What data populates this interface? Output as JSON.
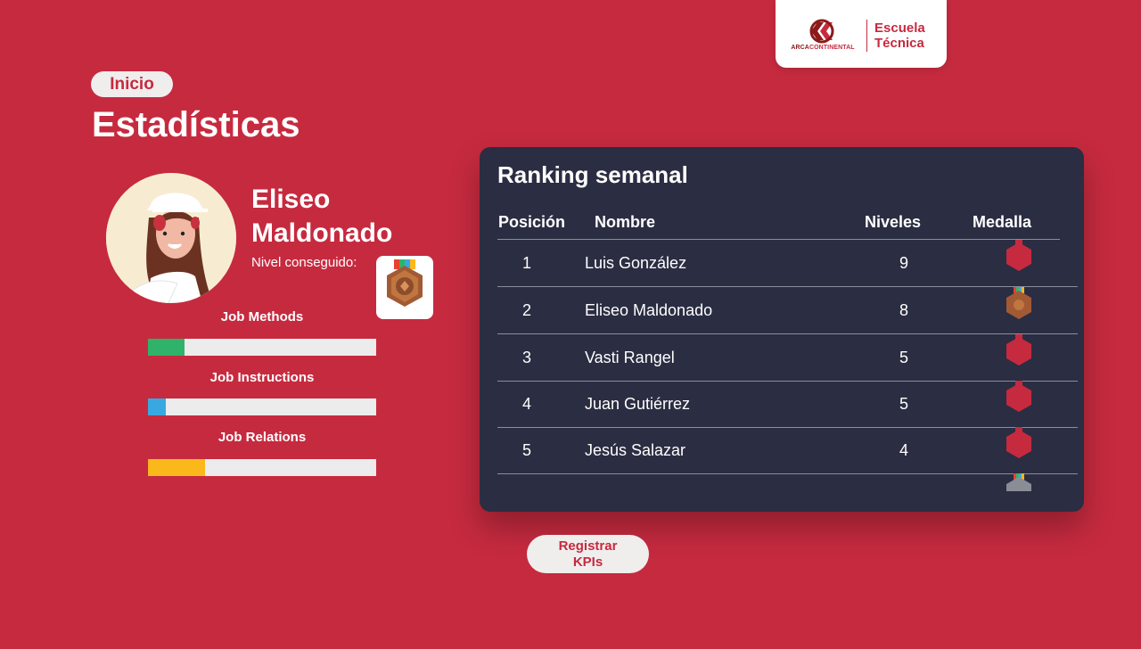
{
  "header": {
    "brand_prefix": "ARCA",
    "brand_suffix": "CONTINENTAL",
    "school_line1": "Escuela",
    "school_line2": "Técnica",
    "brand_color": "#c62a3f"
  },
  "nav": {
    "home_label": "Inicio"
  },
  "page": {
    "title": "Estadísticas"
  },
  "profile": {
    "first_name": "Eliseo",
    "last_name": "Maldonado",
    "level_label": "Nivel conseguido:",
    "level_icon": "bronze-medal-icon"
  },
  "skills": [
    {
      "label": "Job Methods",
      "progress": 0.16,
      "color": "#2fb36b"
    },
    {
      "label": "Job Instructions",
      "progress": 0.08,
      "color": "#3aa8e0"
    },
    {
      "label": "Job Relations",
      "progress": 0.25,
      "color": "#fbb81b"
    }
  ],
  "ranking": {
    "title": "Ranking semanal",
    "columns": {
      "position": "Posición",
      "name": "Nombre",
      "levels": "Niveles",
      "medal": "Medalla"
    },
    "rows": [
      {
        "position": "1",
        "name": "Luis González",
        "levels": "9",
        "medal": "red-medal-icon"
      },
      {
        "position": "2",
        "name": "Eliseo Maldonado",
        "levels": "8",
        "medal": "bronze-medal-icon"
      },
      {
        "position": "3",
        "name": "Vasti Rangel",
        "levels": "5",
        "medal": "red-medal-icon"
      },
      {
        "position": "4",
        "name": "Juan Gutiérrez",
        "levels": "5",
        "medal": "red-medal-icon"
      },
      {
        "position": "5",
        "name": "Jesús Salazar",
        "levels": "4",
        "medal": "red-medal-icon"
      }
    ]
  },
  "actions": {
    "register_line1": "Registrar",
    "register_line2": "KPIs"
  }
}
